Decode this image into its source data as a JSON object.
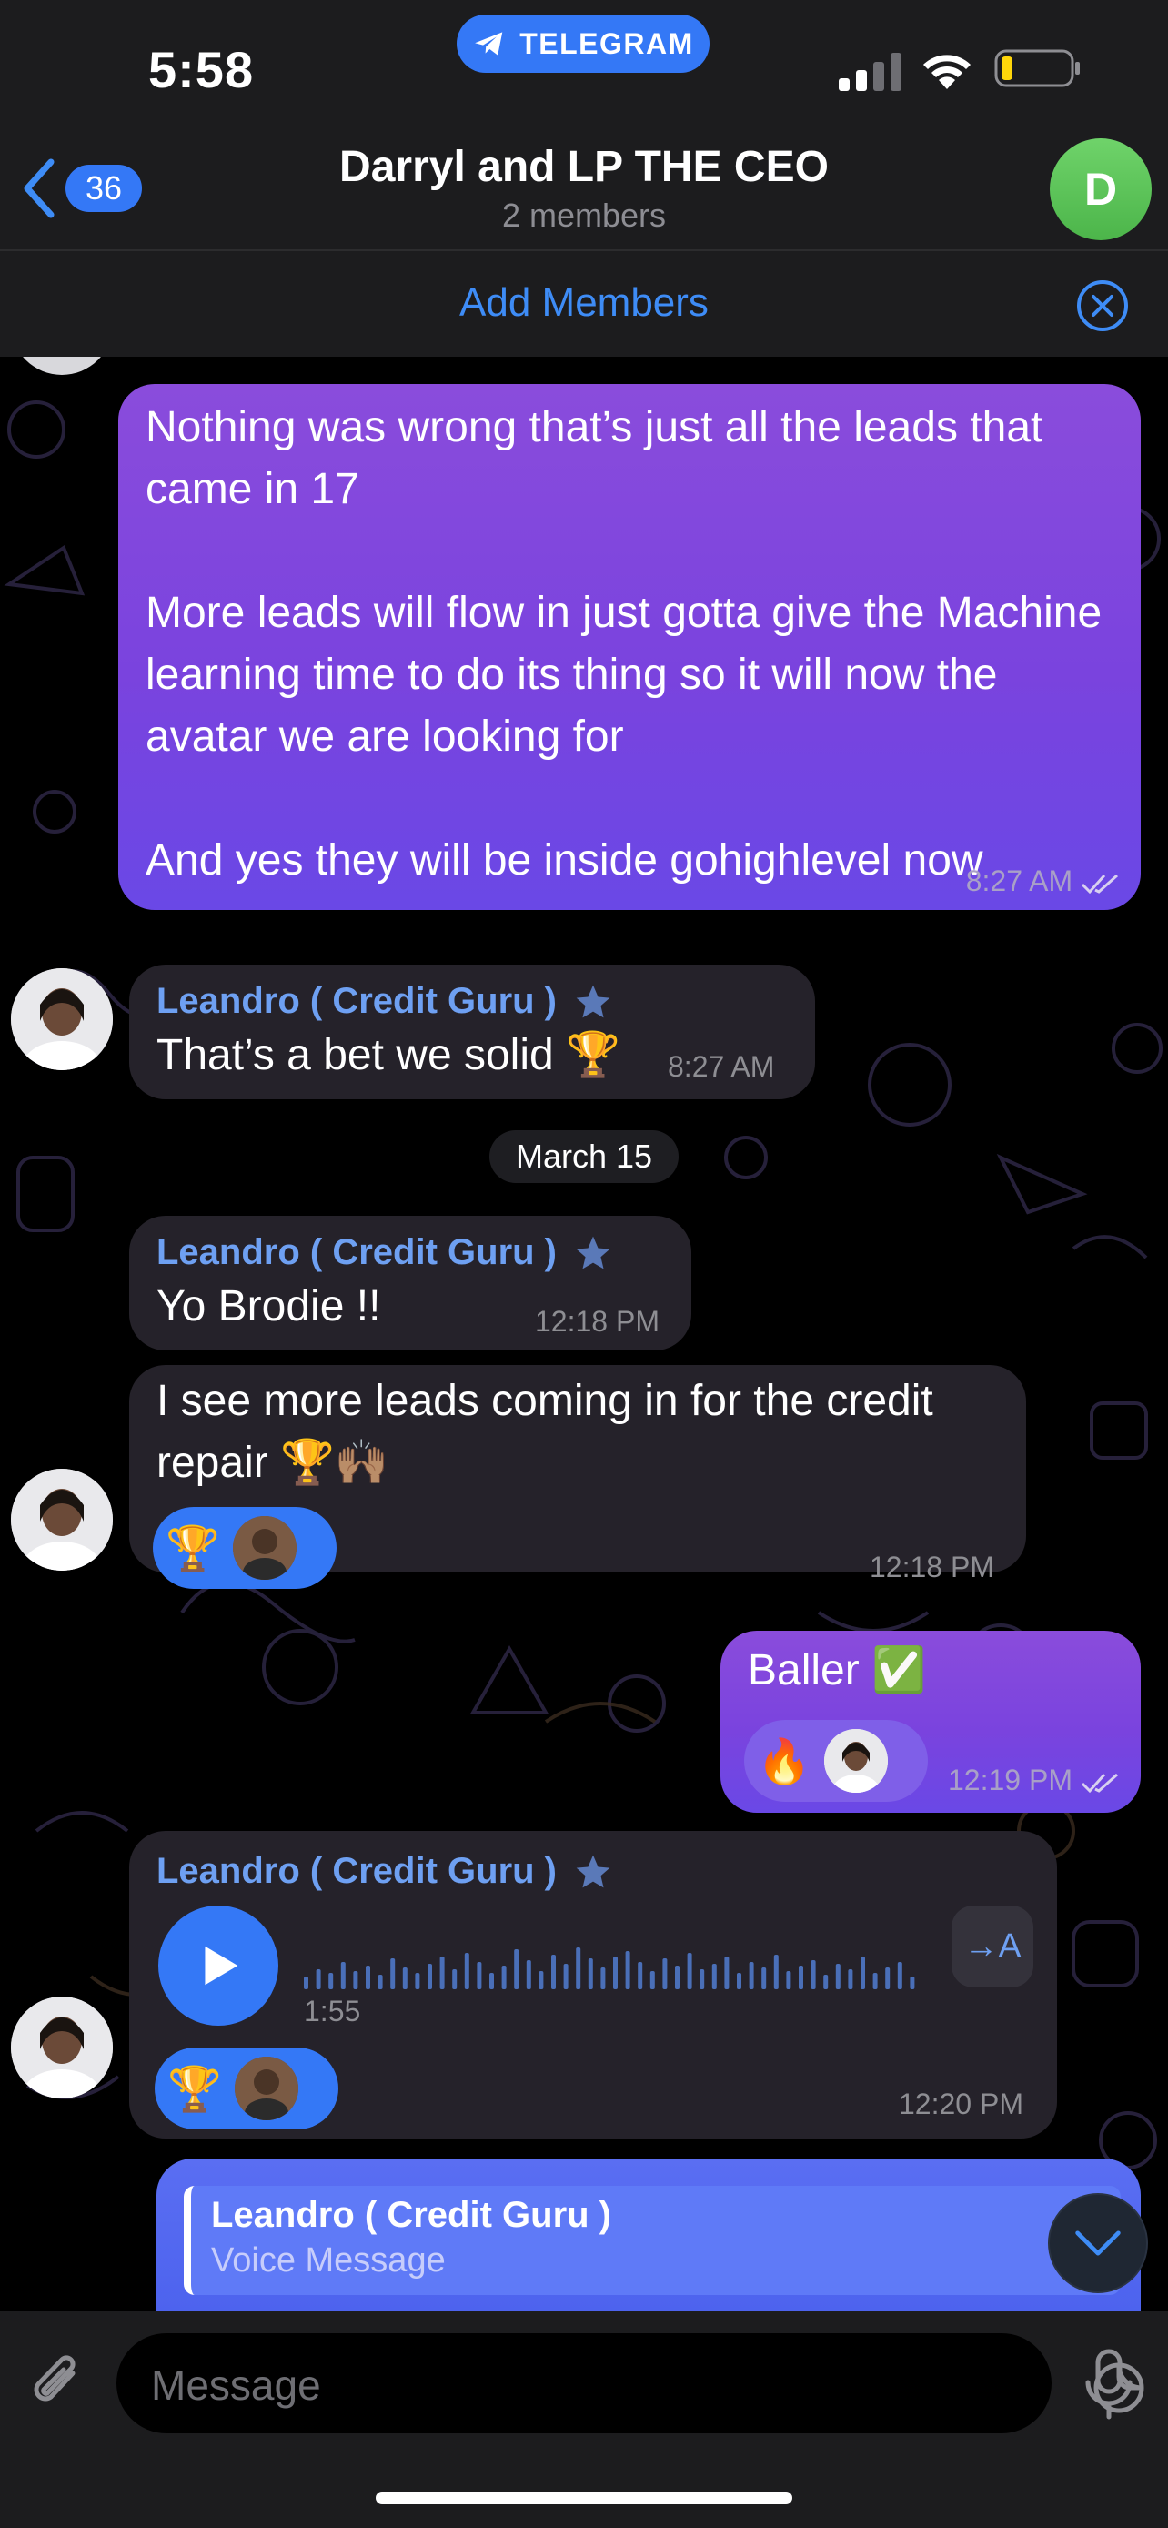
{
  "status_bar": {
    "time": "5:58",
    "app_pill": "TELEGRAM"
  },
  "header": {
    "back_count": "36",
    "title": "Darryl and LP THE CEO",
    "subtitle": "2 members",
    "avatar_letter": "D"
  },
  "add_members": {
    "label": "Add Members"
  },
  "messages": [
    {
      "direction": "outgoing",
      "text": "Nothing was wrong that’s just all the leads that came in 17\n\nMore leads will flow in just gotta give the Machine learning time to do its thing so it will now the avatar we are looking for\n\nAnd yes they will be inside gohighlevel now",
      "time": "8:27 AM"
    },
    {
      "direction": "incoming",
      "sender": "Leandro ( Credit Guru )",
      "text": "That’s a bet we solid 🏆",
      "time": "8:27 AM"
    },
    {
      "direction": "incoming",
      "sender": "Leandro ( Credit Guru )",
      "text": "Yo Brodie !!",
      "time": "12:18 PM"
    },
    {
      "direction": "incoming",
      "text": "I see more leads coming in for the credit repair 🏆🙌🏽",
      "reaction": "🏆",
      "time": "12:18 PM"
    },
    {
      "direction": "outgoing",
      "text": "Baller ✅",
      "reaction": "🔥",
      "time": "12:19 PM"
    },
    {
      "direction": "incoming",
      "sender": "Leandro ( Credit Guru )",
      "voice_duration": "1:55",
      "transcribe_label": "→A",
      "reaction": "🏆",
      "time": "12:20 PM"
    }
  ],
  "date_separator": "March 15",
  "reply_preview": {
    "name": "Leandro ( Credit Guru )",
    "type": "Voice Message"
  },
  "composer": {
    "placeholder": "Message"
  },
  "colors": {
    "accent": "#3478f6",
    "outgoing_bubble": "#7a43de",
    "incoming_bubble": "#25222a",
    "sender_name": "#6ea0f2"
  }
}
